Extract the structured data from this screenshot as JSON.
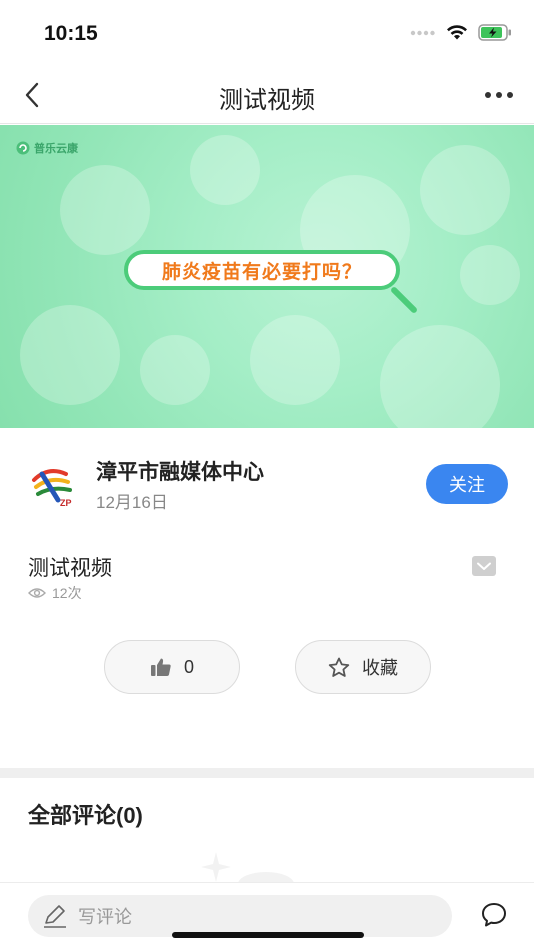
{
  "status_bar": {
    "time": "10:15"
  },
  "nav": {
    "title": "测试视频"
  },
  "video": {
    "overlay_text": "肺炎疫苗有必要打吗？",
    "brand": "普乐云康"
  },
  "author": {
    "name": "漳平市融媒体中心",
    "date": "12月16日",
    "follow_label": "关注"
  },
  "content": {
    "title": "测试视频",
    "views": "12次"
  },
  "actions": {
    "like_count": "0",
    "favorite_label": "收藏"
  },
  "comments": {
    "title": "全部评论(0)",
    "input_placeholder": "写评论"
  },
  "colors": {
    "accent": "#3a86f0",
    "video_green": "#a5eec7",
    "pill_border": "#4ccc7a",
    "pill_text": "#f07a1c"
  },
  "icons": [
    "back-icon",
    "more-icon",
    "wifi-icon",
    "battery-icon",
    "signal-icon",
    "eye-icon",
    "thumb-up-icon",
    "star-icon",
    "pencil-icon",
    "chat-bubble-icon",
    "collapse-icon"
  ]
}
